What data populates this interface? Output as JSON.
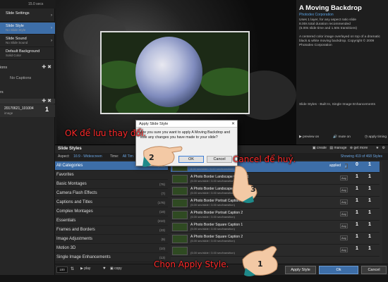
{
  "left": {
    "time": "15.0 secs",
    "items": [
      {
        "title": "Slide Settings",
        "sub": ""
      },
      {
        "title": "Slide Style",
        "sub": "No Slide Style"
      },
      {
        "title": "Slide Sound",
        "sub": "No Slide Sound"
      },
      {
        "title": "Default Background",
        "sub": "Solid Color"
      }
    ],
    "captions_label": "ions",
    "no_captions": "No Captions",
    "images_label": "rs",
    "layer_name": "20170621_101004",
    "layer_type": "image",
    "layer_num": "1"
  },
  "info": {
    "title": "A Moving Backdrop",
    "corp": "Photodex Corporation",
    "desc_lines": [
      "Uses 1 layer, for any aspect ratio slide",
      "8.00s total duration recommended",
      "(5.00s slide time and 1.50s transitions)",
      "",
      "A centered color image overlayed on top of a dramatic",
      "black & white moving backdrop. Copyright © 2009",
      "Photodex Corporation"
    ],
    "category_line": "Slide Styles - Built In, Single Image Enhancements",
    "controls": [
      "preview on",
      "mute on",
      "apply timing"
    ]
  },
  "styles": {
    "header": "Slide Styles",
    "tools": [
      "create",
      "manage",
      "get more"
    ],
    "aspect_label": "Aspect:",
    "aspect_value": "16:9 - Widescreen",
    "time_label": "Time:",
    "time_value": "All Tim",
    "showing": "Showing 419 of 468 Styles",
    "applied": "applied",
    "categories": [
      {
        "name": "All Categories",
        "count": "(468)"
      },
      {
        "name": "Favorites",
        "count": ""
      },
      {
        "name": "Basic Montages",
        "count": "(76)"
      },
      {
        "name": "Camera Flash Effects",
        "count": "(7)"
      },
      {
        "name": "Captions and Titles",
        "count": "(176)"
      },
      {
        "name": "Complex Montages",
        "count": "(19)"
      },
      {
        "name": "Essentials",
        "count": "(210)"
      },
      {
        "name": "Frames and Borders",
        "count": "(23)"
      },
      {
        "name": "Image Adjustments",
        "count": "(9)"
      },
      {
        "name": "Motion 3D",
        "count": "(10)"
      },
      {
        "name": "Single Image Enhancements",
        "count": "(13)"
      },
      {
        "name": "Slide Background",
        "count": ""
      }
    ],
    "rows": [
      {
        "name": "A Moving Backdrop",
        "sub": "8.00 sec/slide / 5.00 sec/transition)",
        "aspect": "Any",
        "layers": "0",
        "captions": "1"
      },
      {
        "name": "A Photo Border Landscape Caption 1",
        "sub": "(5.00 sec/slide / 3.00 sec/transition)",
        "aspect": "Any",
        "layers": "1",
        "captions": "1"
      },
      {
        "name": "A Photo Border Landscape Caption 2",
        "sub": "(5.00 sec/slide / 3.00 sec/transition)",
        "aspect": "Any",
        "layers": "1",
        "captions": "1"
      },
      {
        "name": "A Photo Border Portrait Caption 1",
        "sub": "(5.00 sec/slide / 3.00 sec/transition)",
        "aspect": "Any",
        "layers": "1",
        "captions": "1"
      },
      {
        "name": "A Photo Border Portrait Caption 2",
        "sub": "(5.00 sec/slide / 3.00 sec/transition)",
        "aspect": "Any",
        "layers": "1",
        "captions": "1"
      },
      {
        "name": "A Photo Border Square Caption 1",
        "sub": "(5.00 sec/slide / 3.00 sec/transition)",
        "aspect": "Any",
        "layers": "1",
        "captions": "1"
      },
      {
        "name": "A Photo Border Square Caption 2",
        "sub": "(5.00 sec/slide / 3.00 sec/transition)",
        "aspect": "Any",
        "layers": "1",
        "captions": "1"
      },
      {
        "name": "",
        "sub": "(5.00 sec/slide / 3.00 sec/transition)",
        "aspect": "Any",
        "layers": "1",
        "captions": "1"
      }
    ],
    "col_labels": {
      "captions": "captions",
      "layers": "layer"
    }
  },
  "bottom": {
    "zoom": "100",
    "play": "play",
    "copy": "copy",
    "apply": "Apply Style",
    "ok": "Ok",
    "cancel": "Cancel"
  },
  "dialog": {
    "title": "Apply Slide Style",
    "message": "Are you sure you want to apply A Moving Backdrop and lose any changes you have made to your slide?",
    "ok": "OK",
    "cancel": "Cancel"
  },
  "annotations": {
    "ok_note": "OK để lưu thay đổi.",
    "cancel_note": "Cancel để huỷ.",
    "apply_note": "Chọn Apply Style.",
    "step1": "1",
    "step2": "2",
    "step3": "3"
  }
}
